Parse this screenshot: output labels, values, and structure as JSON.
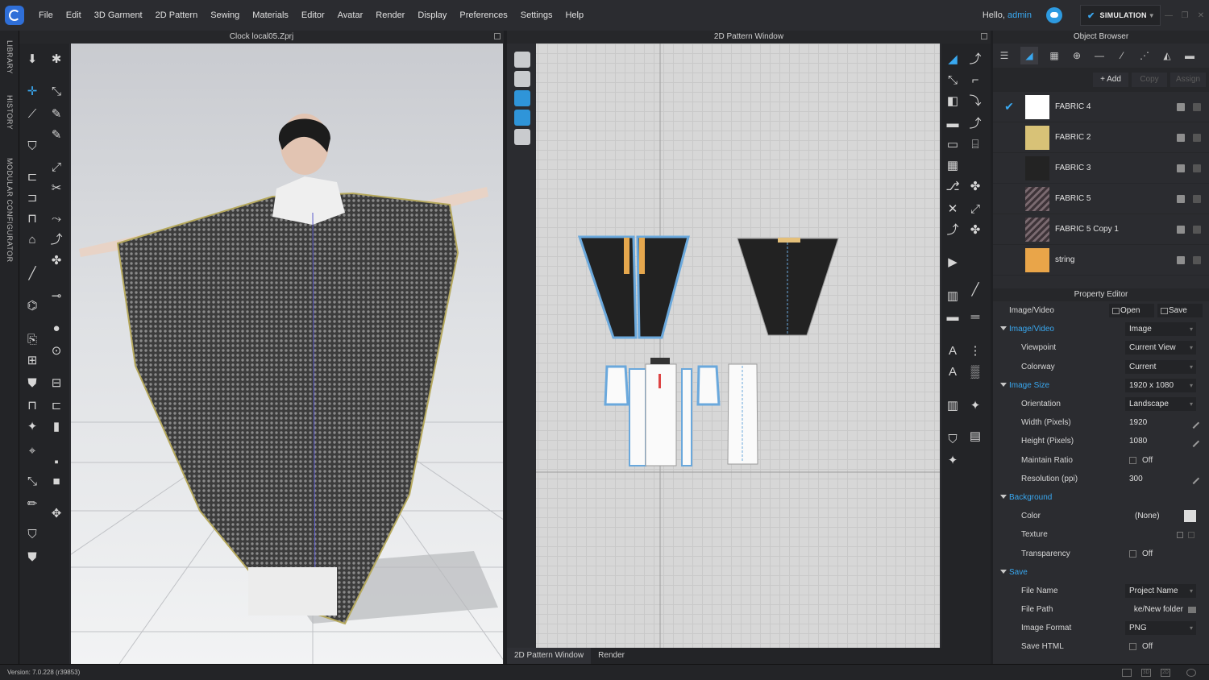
{
  "menubar": {
    "items": [
      "File",
      "Edit",
      "3D Garment",
      "2D Pattern",
      "Sewing",
      "Materials",
      "Editor",
      "Avatar",
      "Render",
      "Display",
      "Preferences",
      "Settings",
      "Help"
    ],
    "hello_prefix": "Hello, ",
    "user": "admin",
    "simulation_label": "SIMULATION"
  },
  "left_tabs": [
    "LIBRARY",
    "HISTORY",
    "MODULAR CONFIGURATOR"
  ],
  "pane3d": {
    "title": "Clock local05.Zprj"
  },
  "pane2d": {
    "title": "2D Pattern Window",
    "tabs": [
      "2D Pattern Window",
      "Render"
    ]
  },
  "object_browser": {
    "title": "Object Browser",
    "actions": {
      "add": "+ Add",
      "copy": "Copy",
      "assign": "Assign"
    },
    "fabrics": [
      {
        "name": "FABRIC 4",
        "selected": true,
        "color": "#ffffff"
      },
      {
        "name": "FABRIC 2",
        "selected": false,
        "color": "#d8c277"
      },
      {
        "name": "FABRIC 3",
        "selected": false,
        "color": "#232323"
      },
      {
        "name": "FABRIC 5",
        "selected": false,
        "color": "#5a4a4e"
      },
      {
        "name": "FABRIC 5 Copy 1",
        "selected": false,
        "color": "#5a4a4e"
      },
      {
        "name": "string",
        "selected": false,
        "color": "#e9a549"
      }
    ]
  },
  "property_editor": {
    "title": "Property Editor",
    "image_video_label": "Image/Video",
    "open_label": "Open",
    "save_label": "Save",
    "image_video_section": "Image/Video",
    "image_video_value": "Image",
    "viewpoint_label": "Viewpoint",
    "viewpoint_value": "Current View",
    "colorway_label": "Colorway",
    "colorway_value": "Current",
    "image_size_section": "Image Size",
    "image_size_value": "1920 x 1080",
    "orientation_label": "Orientation",
    "orientation_value": "Landscape",
    "width_label": "Width (Pixels)",
    "width_value": "1920",
    "height_label": "Height (Pixels)",
    "height_value": "1080",
    "maintain_ratio_label": "Maintain Ratio",
    "maintain_ratio_value": "Off",
    "resolution_label": "Resolution (ppi)",
    "resolution_value": "300",
    "background_section": "Background",
    "color_label": "Color",
    "color_value": "(None)",
    "texture_label": "Texture",
    "transparency_label": "Transparency",
    "transparency_value": "Off",
    "save_section": "Save",
    "file_name_label": "File Name",
    "file_name_value": "Project Name",
    "file_path_label": "File Path",
    "file_path_value": "ke/New folder",
    "image_format_label": "Image Format",
    "image_format_value": "PNG",
    "save_html_label": "Save HTML",
    "save_html_value": "Off"
  },
  "status": {
    "version": "Version: 7.0.228 (r39853)"
  },
  "colors": {
    "accent": "#39a8f0",
    "panel": "#2b2c30",
    "pattern_outline": "#6aa8dc"
  }
}
